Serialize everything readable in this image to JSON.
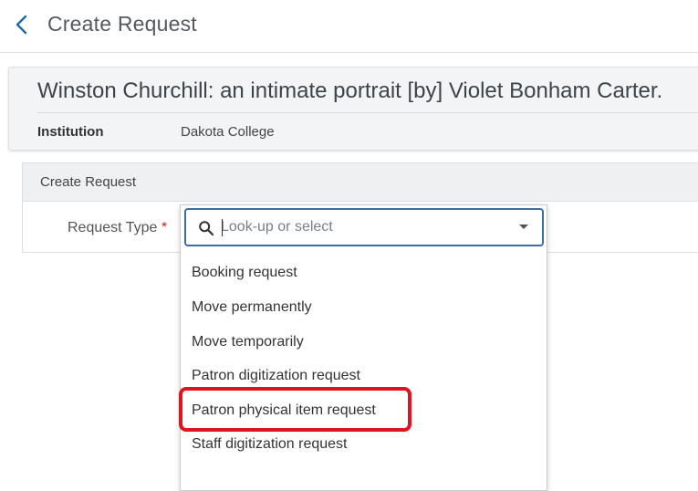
{
  "header": {
    "title": "Create Request",
    "back_icon": "chevron-left-icon",
    "accent_color": "#1a6aa8"
  },
  "record": {
    "title": "Winston Churchill: an intimate portrait [by] Violet Bonham Carter.",
    "institution_label": "Institution",
    "institution_value": "Dakota College"
  },
  "form": {
    "section_title": "Create Request",
    "request_type_label": "Request Type",
    "required_marker": "*",
    "request_type": {
      "placeholder": "Look-up or select",
      "value": "",
      "search_icon": "search-icon",
      "expand_icon": "caret-down-icon",
      "options": [
        "Booking request",
        "Move permanently",
        "Move temporarily",
        "Patron digitization request",
        "Patron physical item request",
        "Staff digitization request"
      ],
      "highlighted_option": "Patron physical item request",
      "highlight_color": "#e0141e"
    }
  }
}
